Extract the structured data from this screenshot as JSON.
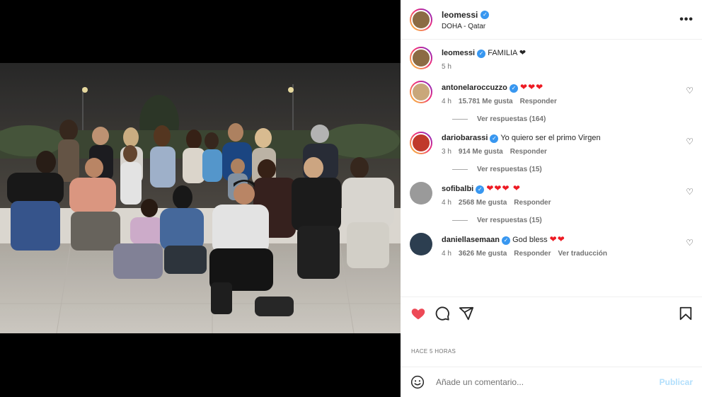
{
  "header": {
    "username": "leomessi",
    "location": "DOHA - Qatar"
  },
  "caption": {
    "username": "leomessi",
    "text": "FAMILIA ❤",
    "time": "5 h"
  },
  "comments": [
    {
      "username": "antonelaroccuzzo",
      "verified": true,
      "text": "",
      "hearts": "❤❤❤",
      "time": "4 h",
      "likes": "15.781 Me gusta",
      "reply": "Responder",
      "extra": "",
      "view_replies": "Ver respuestas (164)",
      "avatar_color": "#c9a77a"
    },
    {
      "username": "dariobarassi",
      "verified": true,
      "text": "Yo quiero ser el primo Virgen",
      "hearts": "",
      "time": "3 h",
      "likes": "914 Me gusta",
      "reply": "Responder",
      "extra": "",
      "view_replies": "Ver respuestas (15)",
      "avatar_color": "#c0392b"
    },
    {
      "username": "sofibalbi",
      "verified": true,
      "text": "",
      "hearts": "❤❤❤ ❤",
      "time": "4 h",
      "likes": "2568 Me gusta",
      "reply": "Responder",
      "extra": "",
      "view_replies": "Ver respuestas (15)",
      "avatar_color": "#9a9a9a"
    },
    {
      "username": "daniellasemaan",
      "verified": true,
      "text": "God bless",
      "hearts": "❤❤",
      "time": "4 h",
      "likes": "3626 Me gusta",
      "reply": "Responder",
      "extra": "Ver traducción",
      "view_replies": "",
      "avatar_color": "#2c3e50"
    }
  ],
  "actions": {
    "like_icon": "heart-filled-icon",
    "comment_icon": "comment-icon",
    "share_icon": "share-icon",
    "save_icon": "bookmark-icon"
  },
  "time_label": "HACE 5 HORAS",
  "add_comment": {
    "placeholder": "Añade un comentario...",
    "publish": "Publicar"
  },
  "colors": {
    "heart": "#ed4956",
    "verified": "#3897f0",
    "publish_disabled": "#b2dffc"
  }
}
